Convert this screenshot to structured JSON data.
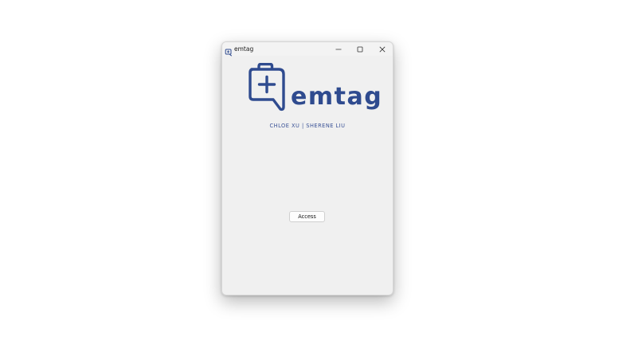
{
  "window": {
    "title": "emtag",
    "controls": {
      "minimize_icon": "minimize-icon",
      "maximize_icon": "maximize-icon",
      "close_icon": "close-icon"
    }
  },
  "logo": {
    "wordmark": "emtag",
    "icon": "medical-chat-bubble-icon",
    "color": "#2f4b8f"
  },
  "authors": "CHLOE XU | SHERENE LIU",
  "access_button": {
    "label": "Access"
  }
}
